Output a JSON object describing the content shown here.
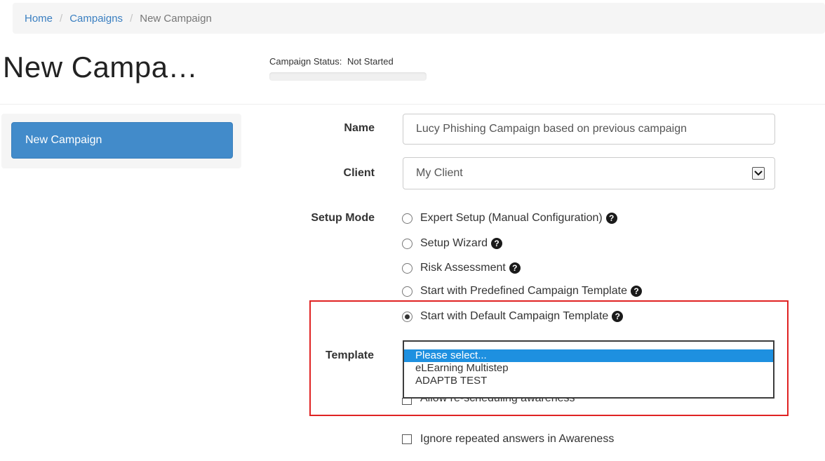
{
  "breadcrumb": {
    "items": [
      {
        "label": "Home",
        "link": true
      },
      {
        "label": "Campaigns",
        "link": true
      },
      {
        "label": "New Campaign",
        "link": false
      }
    ],
    "separator": "/"
  },
  "page": {
    "title": "New Campa…"
  },
  "status": {
    "label": "Campaign Status:",
    "value": "Not Started"
  },
  "sidebar": {
    "button_label": "New Campaign"
  },
  "form": {
    "name": {
      "label": "Name",
      "value": "Lucy Phishing Campaign based on previous campaign"
    },
    "client": {
      "label": "Client",
      "value": "My Client"
    },
    "setup_mode": {
      "label": "Setup Mode",
      "options": [
        {
          "label": "Expert Setup (Manual Configuration)",
          "checked": false
        },
        {
          "label": "Setup Wizard",
          "checked": false
        },
        {
          "label": "Risk Assessment",
          "checked": false
        },
        {
          "label": "Start with Predefined Campaign Template",
          "checked": false
        },
        {
          "label": "Start with Default Campaign Template",
          "checked": true
        }
      ]
    },
    "template": {
      "label": "Template",
      "options": [
        "Please select...",
        "eLEarning Multistep",
        "ADAPTB TEST"
      ],
      "selected": "Please select..."
    },
    "checkboxes": [
      {
        "label": "Allow re-scheduling awareness",
        "checked": false
      },
      {
        "label": "Ignore repeated answers in Awareness",
        "checked": false
      }
    ]
  },
  "icons": {
    "help": "question-circle-icon",
    "select_arrow": "chevron-down-icon"
  },
  "colors": {
    "link": "#3a7fc1",
    "primary_button": "#428bca",
    "highlight_box": "#e02323",
    "dropdown_selected": "#1e90e0"
  }
}
